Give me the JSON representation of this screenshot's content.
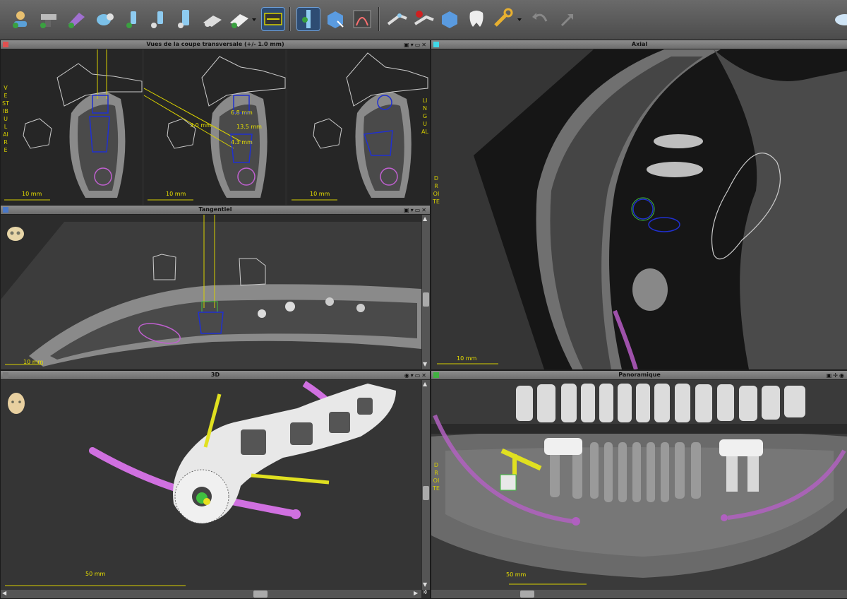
{
  "toolbar": {
    "buttons": [
      {
        "name": "patient-tool-icon"
      },
      {
        "name": "implant-tool-1-icon"
      },
      {
        "name": "implant-tool-2-icon"
      },
      {
        "name": "implant-tool-3-icon"
      },
      {
        "name": "implant-tool-4-icon"
      },
      {
        "name": "implant-tool-5-icon"
      },
      {
        "name": "implant-tool-6-icon"
      },
      {
        "name": "implant-tool-7-icon"
      },
      {
        "name": "implant-tool-8-icon"
      }
    ]
  },
  "panels": {
    "transversal": {
      "title": "Vues de la coupe transversale (+/- 1.0 mm)",
      "scale": "10 mm",
      "side_left": "VESTIBULAIRE",
      "side_right": "LINGUAL",
      "annotations": {
        "a1": "3.0 mm",
        "a2": "6.8 mm",
        "a3": "13.5 mm",
        "a4": "4.3 mm"
      }
    },
    "axial": {
      "title": "Axial",
      "scale": "10 mm",
      "side": "DROITE"
    },
    "tangentiel": {
      "title": "Tangentiel",
      "scale": "10 mm"
    },
    "threed": {
      "title": "3D",
      "scale": "50 mm"
    },
    "panoramique": {
      "title": "Panoramique",
      "scale": "50 mm",
      "side": "DROITE"
    }
  },
  "colors": {
    "transversal_indicator": "#e05050",
    "axial_indicator": "#40d8e8",
    "tangentiel_indicator": "#4a78c8",
    "threed_indicator": "#7a7a7a",
    "panoramique_indicator": "#40b040",
    "implant": "#2030d0",
    "nerve": "#c060d0",
    "guide_line": "#e8e000"
  }
}
